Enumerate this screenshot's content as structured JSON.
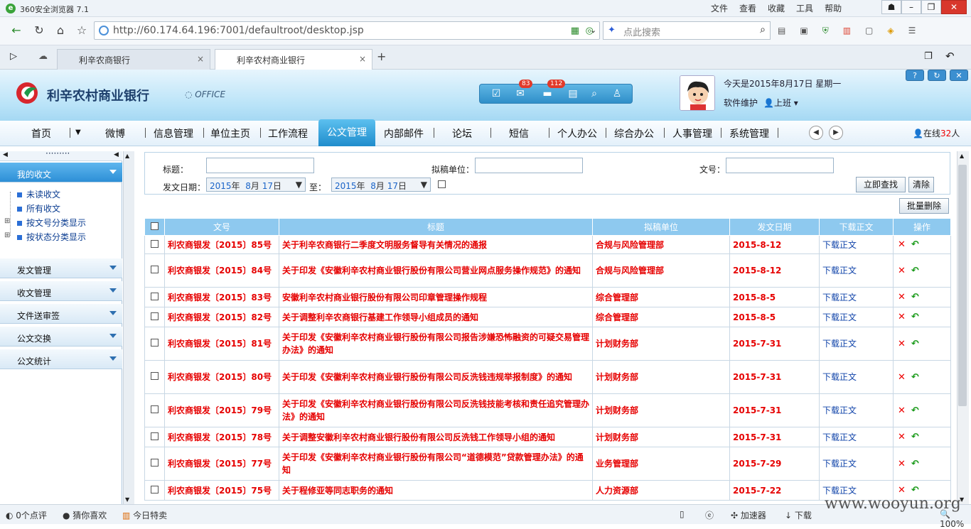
{
  "browser": {
    "title": "360安全浏览器 7.1",
    "menus": [
      "文件",
      "查看",
      "收藏",
      "工具",
      "帮助"
    ],
    "url": "http://60.174.64.196:7001/defaultroot/desktop.jsp",
    "search_placeholder": "点此搜索",
    "tabs": [
      {
        "label": "利辛农商银行",
        "active": false
      },
      {
        "label": "利辛农村商业银行",
        "active": true
      }
    ],
    "status": {
      "comments": "0个点评",
      "guess": "猜你喜欢",
      "sale": "今日特卖",
      "accelerator": "加速器",
      "download": "下载",
      "zoom": "100%"
    }
  },
  "app": {
    "brand": "利辛农村商业银行",
    "office": "OFFICE",
    "mail_badge": "83",
    "task_badge": "112",
    "today": "今天是2015年8月17日  星期一",
    "user_role": "软件维护",
    "duty": "上班",
    "online_prefix": "在线",
    "online_count": "32",
    "online_suffix": "人"
  },
  "mainnav": {
    "items": [
      "首页",
      "微博",
      "信息管理",
      "单位主页",
      "工作流程",
      "公文管理",
      "内部邮件",
      "论坛",
      "短信",
      "个人办公",
      "综合办公",
      "人事管理",
      "系统管理"
    ],
    "active": "公文管理"
  },
  "sidebar": {
    "sections": [
      {
        "label": "我的收文",
        "active": true,
        "items": [
          {
            "label": "未读收文",
            "expandable": false
          },
          {
            "label": "所有收文",
            "expandable": false
          },
          {
            "label": "按文号分类显示",
            "expandable": true
          },
          {
            "label": "按状态分类显示",
            "expandable": true
          }
        ]
      },
      {
        "label": "发文管理",
        "active": false
      },
      {
        "label": "收文管理",
        "active": false
      },
      {
        "label": "文件送审签",
        "active": false
      },
      {
        "label": "公文交换",
        "active": false
      },
      {
        "label": "公文统计",
        "active": false
      }
    ]
  },
  "filter": {
    "title_label": "标题：",
    "unit_label": "拟稿单位：",
    "docno_label": "文号：",
    "date_label": "发文日期：",
    "to_label": "至：",
    "date_from": {
      "year": "2015",
      "y_unit": "年",
      "month": "8",
      "m_unit": "月",
      "day": "17",
      "d_unit": "日"
    },
    "date_to": {
      "year": "2015",
      "y_unit": "年",
      "month": "8",
      "m_unit": "月",
      "day": "17",
      "d_unit": "日"
    },
    "search_btn": "立即查找",
    "clear_btn": "清除",
    "batch_delete": "批量删除"
  },
  "table": {
    "headers": [
      "",
      "文号",
      "标题",
      "拟稿单位",
      "发文日期",
      "下载正文",
      "操作"
    ],
    "rows": [
      {
        "docno": "利农商银发〔2015〕85号",
        "title": "关于利辛农商银行二季度文明服务督导有关情况的通报",
        "unit": "合规与风险管理部",
        "date": "2015-8-12",
        "download": "下载正文"
      },
      {
        "docno": "利农商银发〔2015〕84号",
        "title": "关于印发《安徽利辛农村商业银行股份有限公司营业网点服务操作规范》的通知",
        "unit": "合规与风险管理部",
        "date": "2015-8-12",
        "download": "下载正文"
      },
      {
        "docno": "利农商银发〔2015〕83号",
        "title": "安徽利辛农村商业银行股份有限公司印章管理操作规程",
        "unit": "综合管理部",
        "date": "2015-8-5",
        "download": "下载正文"
      },
      {
        "docno": "利农商银发〔2015〕82号",
        "title": "关于调整利辛农商银行基建工作领导小组成员的通知",
        "unit": "综合管理部",
        "date": "2015-8-5",
        "download": "下载正文"
      },
      {
        "docno": "利农商银发〔2015〕81号",
        "title": "关于印发《安徽利辛农村商业银行股份有限公司报告涉嫌恐怖融资的可疑交易管理办法》的通知",
        "unit": "计划财务部",
        "date": "2015-7-31",
        "download": "下载正文"
      },
      {
        "docno": "利农商银发〔2015〕80号",
        "title": "关于印发《安徽利辛农村商业银行股份有限公司反洗钱违规举报制度》的通知",
        "unit": "计划财务部",
        "date": "2015-7-31",
        "download": "下载正文"
      },
      {
        "docno": "利农商银发〔2015〕79号",
        "title": "关于印发《安徽利辛农村商业银行股份有限公司反洗钱技能考核和责任追究管理办法》的通知",
        "unit": "计划财务部",
        "date": "2015-7-31",
        "download": "下载正文"
      },
      {
        "docno": "利农商银发〔2015〕78号",
        "title": "关于调整安徽利辛农村商业银行股份有限公司反洗钱工作领导小组的通知",
        "unit": "计划财务部",
        "date": "2015-7-31",
        "download": "下载正文"
      },
      {
        "docno": "利农商银发〔2015〕77号",
        "title": "关于印发《安徽利辛农村商业银行股份有限公司“道德模范”贷款管理办法》的通知",
        "unit": "业务管理部",
        "date": "2015-7-29",
        "download": "下载正文"
      },
      {
        "docno": "利农商银发〔2015〕75号",
        "title": "关于程修亚等同志职务的通知",
        "unit": "人力资源部",
        "date": "2015-7-22",
        "download": "下载正文"
      }
    ]
  },
  "watermark": "www.wooyun.org"
}
